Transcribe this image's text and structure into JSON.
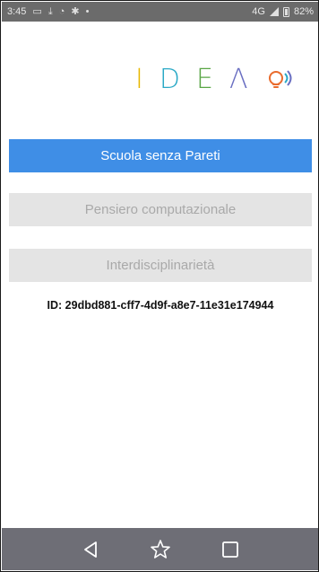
{
  "status_bar": {
    "time": "3:45",
    "network": "4G",
    "battery": "82%",
    "icons": [
      "message-icon",
      "download-icon",
      "sync-icon",
      "puzzle-icon",
      "dot-icon"
    ]
  },
  "logo": {
    "letters": [
      "I",
      "D",
      "E",
      "Λ"
    ],
    "colors": [
      "#e8b700",
      "#2aa9c6",
      "#5aa646",
      "#6a6fc2",
      "#e96b2c"
    ]
  },
  "menu": {
    "items": [
      {
        "label": "Scuola senza Pareti",
        "state": "active"
      },
      {
        "label": "Pensiero computazionale",
        "state": "inactive"
      },
      {
        "label": "Interdisciplinarietà",
        "state": "inactive"
      }
    ]
  },
  "device_id": "ID: 29dbd881-cff7-4d9f-a8e7-11e31e174944",
  "nav_bar": {
    "buttons": [
      "back-icon",
      "star-icon",
      "square-icon"
    ]
  },
  "colors": {
    "accent": "#3f8ee6",
    "inactive_bg": "#e4e4e4",
    "inactive_text": "#a9a9a9",
    "nav_bar": "#6e6e76",
    "status_bar": "#6b6b6b"
  }
}
